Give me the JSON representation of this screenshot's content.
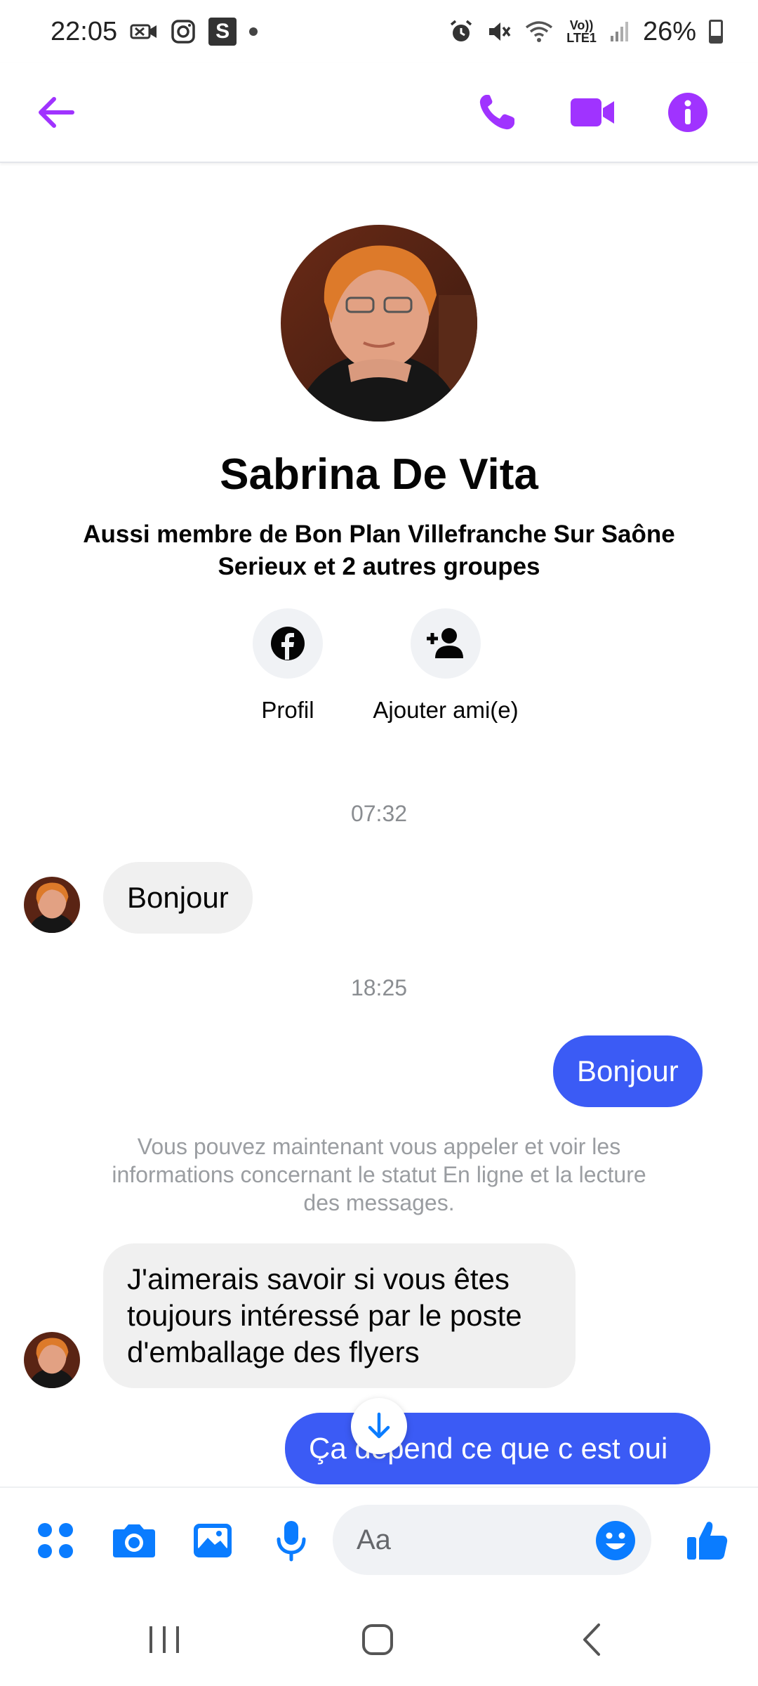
{
  "status_bar": {
    "time": "22:05",
    "s_label": "S",
    "volte": "Vo))",
    "lte": "LTE1",
    "battery_percent": "26%",
    "icons": [
      "video-call-notification-icon",
      "instagram-icon",
      "s-app-icon",
      "alarm-icon",
      "mute-icon",
      "wifi-icon",
      "signal-icon",
      "battery-icon"
    ]
  },
  "header": {
    "icons": [
      "back-arrow-icon",
      "phone-icon",
      "video-camera-icon",
      "info-icon"
    ],
    "accent_color": "#a033ff"
  },
  "profile": {
    "name": "Sabrina De Vita",
    "subtitle": "Aussi membre de Bon Plan Villefranche Sur Saône Serieux et 2 autres groupes",
    "actions": [
      {
        "label": "Profil",
        "icon": "facebook-icon"
      },
      {
        "label": "Ajouter ami(e)",
        "icon": "add-friend-icon"
      }
    ]
  },
  "conversation": {
    "timestamp_1": "07:32",
    "msg_in_1": "Bonjour",
    "timestamp_2": "18:25",
    "msg_out_1": "Bonjour",
    "notice": "Vous pouvez maintenant vous appeler et voir les informations concernant le statut En ligne et la lecture des messages.",
    "msg_in_2": "J'aimerais savoir si vous êtes toujours intéressé par le poste d'emballage des flyers",
    "msg_out_2": "Ça dépend ce que c est oui",
    "outgoing_color": "#3b5bf5",
    "incoming_color": "#f0f0f0"
  },
  "composer": {
    "placeholder": "Aa",
    "icons": [
      "menu-dots-icon",
      "camera-icon",
      "gallery-icon",
      "microphone-icon",
      "emoji-icon",
      "like-thumb-icon"
    ],
    "icon_color": "#0a7cff"
  },
  "nav_bar": {
    "icons": [
      "recent-apps-icon",
      "home-icon",
      "back-icon"
    ]
  }
}
